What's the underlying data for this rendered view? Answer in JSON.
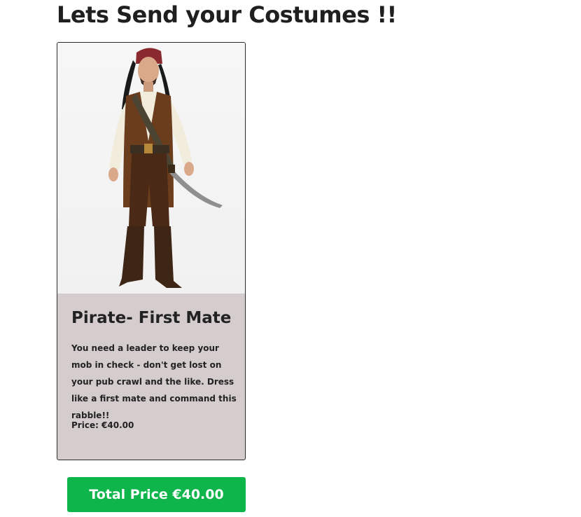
{
  "page": {
    "title": "Lets Send your Costumes !!"
  },
  "card": {
    "image_alt": "Pirate costume",
    "title": "Pirate- First Mate",
    "description": "You need a leader to keep your mob in check - don't get lost on your pub crawl and the like. Dress like a first mate and command this rabble!!",
    "price_text": "Price: €40.00"
  },
  "footer": {
    "total_label": "Total Price €40.00"
  },
  "colors": {
    "card_body_bg": "#d5cdcd",
    "button_bg": "#0db54a",
    "button_text": "#ffffff",
    "title_text": "#1f1f1f"
  }
}
